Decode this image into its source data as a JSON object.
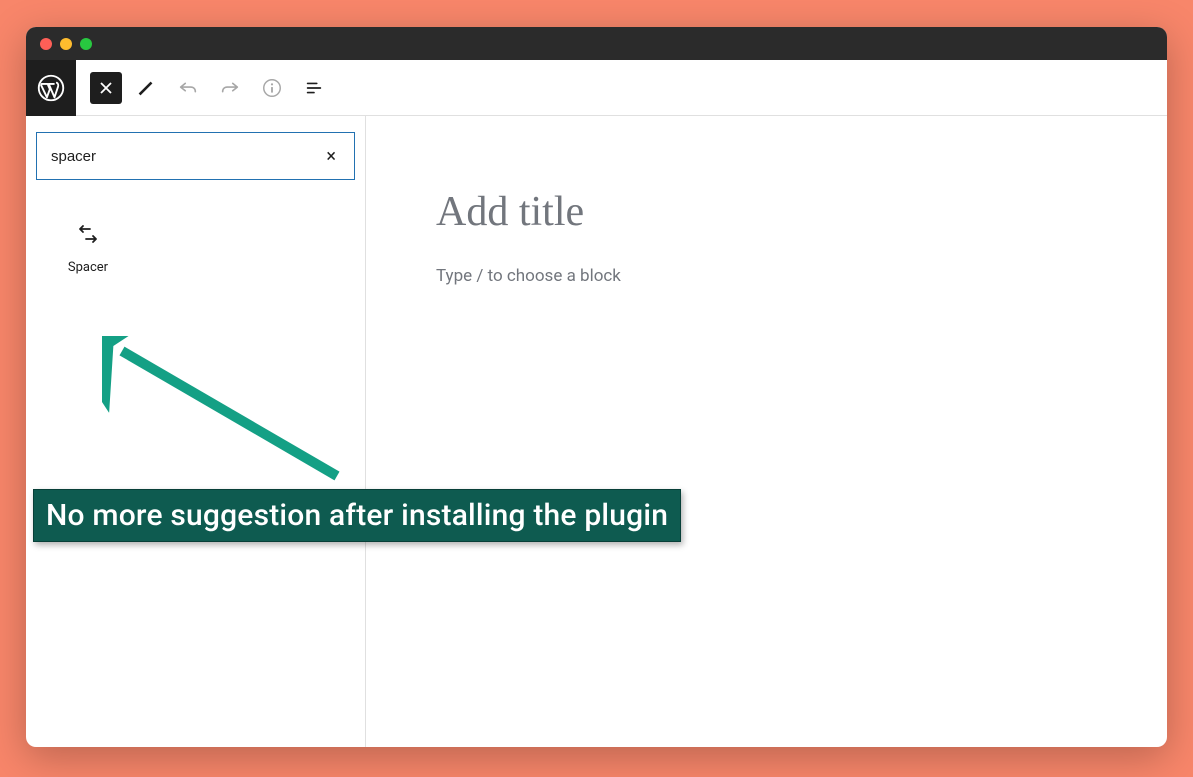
{
  "search": {
    "value": "spacer",
    "clear_label": "×"
  },
  "blocks": {
    "items": [
      {
        "label": "Spacer"
      }
    ]
  },
  "editor": {
    "title_placeholder": "Add title",
    "body_placeholder": "Type / to choose a block"
  },
  "annotation": {
    "text": "No more suggestion after installing the plugin"
  }
}
